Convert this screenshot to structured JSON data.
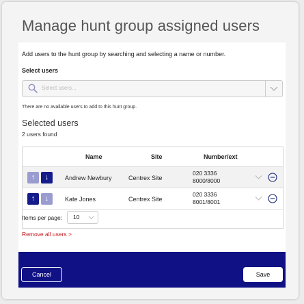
{
  "dialog": {
    "title": "Manage hunt group assigned users",
    "intro": "Add users to the hunt group by searching and selecting a name or number.",
    "select_users_label": "Select users",
    "search": {
      "placeholder": "Select users..."
    },
    "no_available": "There are no available users to add to this hunt group.",
    "selected_heading": "Selected users",
    "found_count": "2 users found"
  },
  "table": {
    "columns": [
      "Name",
      "Site",
      "Number/ext"
    ],
    "rows": [
      {
        "name": "Andrew Newbury",
        "site": "Centrex Site",
        "number_line1": "020 3336",
        "number_line2": "8000/8000",
        "up_enabled": false,
        "down_enabled": true
      },
      {
        "name": "Kate Jones",
        "site": "Centrex Site",
        "number_line1": "020 3336",
        "number_line2": "8001/8001",
        "up_enabled": true,
        "down_enabled": false
      }
    ],
    "up_glyph": "↑",
    "down_glyph": "↓"
  },
  "pagination": {
    "label": "Items per page:",
    "value": "10"
  },
  "remove_all": "Remove all users >",
  "footer": {
    "cancel_label": "Cancel",
    "save_label": "Save"
  },
  "colors": {
    "accent": "#0f1185",
    "arrow_active": "#131c8a",
    "arrow_disabled": "#9a9cd0",
    "danger": "#c3171d"
  }
}
